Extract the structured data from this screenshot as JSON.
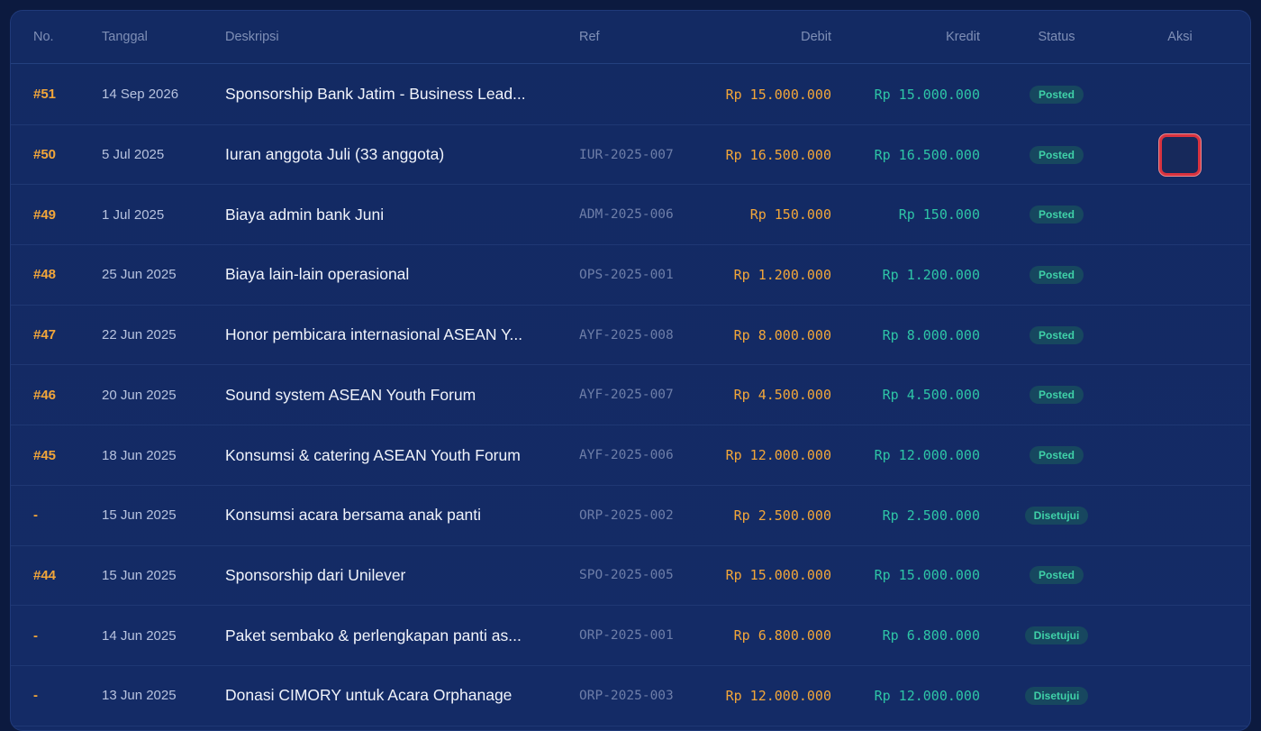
{
  "table": {
    "columns": [
      "No.",
      "Tanggal",
      "Deskripsi",
      "Ref",
      "Debit",
      "Kredit",
      "Status",
      "Aksi"
    ],
    "rows": [
      {
        "no": "#51",
        "date": "14 Sep 2026",
        "desc": "Sponsorship Bank Jatim - Business Lead...",
        "ref": "",
        "debit": "Rp 15.000.000",
        "kredit": "Rp 15.000.000",
        "status": "Posted",
        "action": false
      },
      {
        "no": "#50",
        "date": "5 Jul 2025",
        "desc": "Iuran anggota Juli (33 anggota)",
        "ref": "IUR-2025-007",
        "debit": "Rp 16.500.000",
        "kredit": "Rp 16.500.000",
        "status": "Posted",
        "action": true
      },
      {
        "no": "#49",
        "date": "1 Jul 2025",
        "desc": "Biaya admin bank Juni",
        "ref": "ADM-2025-006",
        "debit": "Rp 150.000",
        "kredit": "Rp 150.000",
        "status": "Posted",
        "action": false
      },
      {
        "no": "#48",
        "date": "25 Jun 2025",
        "desc": "Biaya lain-lain operasional",
        "ref": "OPS-2025-001",
        "debit": "Rp 1.200.000",
        "kredit": "Rp 1.200.000",
        "status": "Posted",
        "action": false
      },
      {
        "no": "#47",
        "date": "22 Jun 2025",
        "desc": "Honor pembicara internasional ASEAN Y...",
        "ref": "AYF-2025-008",
        "debit": "Rp 8.000.000",
        "kredit": "Rp 8.000.000",
        "status": "Posted",
        "action": false
      },
      {
        "no": "#46",
        "date": "20 Jun 2025",
        "desc": "Sound system ASEAN Youth Forum",
        "ref": "AYF-2025-007",
        "debit": "Rp 4.500.000",
        "kredit": "Rp 4.500.000",
        "status": "Posted",
        "action": false
      },
      {
        "no": "#45",
        "date": "18 Jun 2025",
        "desc": "Konsumsi & catering ASEAN Youth Forum",
        "ref": "AYF-2025-006",
        "debit": "Rp 12.000.000",
        "kredit": "Rp 12.000.000",
        "status": "Posted",
        "action": false
      },
      {
        "no": "-",
        "date": "15 Jun 2025",
        "desc": "Konsumsi acara bersama anak panti",
        "ref": "ORP-2025-002",
        "debit": "Rp 2.500.000",
        "kredit": "Rp 2.500.000",
        "status": "Disetujui",
        "action": false
      },
      {
        "no": "#44",
        "date": "15 Jun 2025",
        "desc": "Sponsorship dari Unilever",
        "ref": "SPO-2025-005",
        "debit": "Rp 15.000.000",
        "kredit": "Rp 15.000.000",
        "status": "Posted",
        "action": false
      },
      {
        "no": "-",
        "date": "14 Jun 2025",
        "desc": "Paket sembako & perlengkapan panti as...",
        "ref": "ORP-2025-001",
        "debit": "Rp 6.800.000",
        "kredit": "Rp 6.800.000",
        "status": "Disetujui",
        "action": false
      },
      {
        "no": "-",
        "date": "13 Jun 2025",
        "desc": "Donasi CIMORY untuk Acara Orphanage",
        "ref": "ORP-2025-003",
        "debit": "Rp 12.000.000",
        "kredit": "Rp 12.000.000",
        "status": "Disetujui",
        "action": false
      }
    ]
  }
}
